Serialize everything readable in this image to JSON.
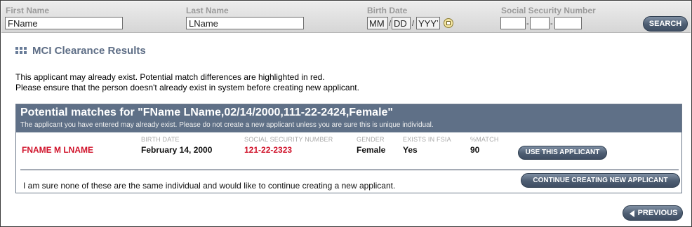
{
  "search": {
    "first_name_label": "First Name",
    "first_name_value": "FName",
    "last_name_label": "Last Name",
    "last_name_value": "LName",
    "birth_date_label": "Birth Date",
    "birth_mm": "MM",
    "birth_dd": "DD",
    "birth_yyyy": "YYYY",
    "date_sep": "/",
    "ssn_label": "Social Security Number",
    "ssn_part1": "",
    "ssn_part2": "",
    "ssn_part3": "",
    "ssn_sep": "-",
    "search_button": "SEARCH"
  },
  "page": {
    "title": "MCI Clearance Results",
    "intro_line1": "This applicant may already exist. Potential match differences are highlighted in red.",
    "intro_line2": "Please ensure that the person doesn't already exist in system before creating new applicant."
  },
  "results": {
    "header_title": "Potential matches for \"FName LName,02/14/2000,111-22-2424,Female\"",
    "header_subtitle": "The applicant you have entered may already exist. Please do not create a new applicant unless you are sure this is unique individual.",
    "columns": {
      "birth_date": "BIRTH DATE",
      "ssn": "SOCIAL SECURITY NUMBER",
      "gender": "GENDER",
      "exists": "EXISTS IN FSIA",
      "match": "%MATCH"
    },
    "match_row": {
      "name": "FNAME M LNAME",
      "birth_date": "February 14, 2000",
      "ssn": "121-22-2323",
      "gender": "Female",
      "exists": "Yes",
      "match": "90",
      "use_button": "USE THIS APPLICANT"
    },
    "confirm_text": "I am sure none of these are the same individual and would like to continue creating a new applicant.",
    "continue_button": "CONTINUE CREATING NEW APPLICANT"
  },
  "nav": {
    "previous_button": "PREVIOUS"
  },
  "colors": {
    "header_bg": "#5f7087",
    "mismatch_red": "#d0122a",
    "button_dark": "#4d5d72"
  }
}
